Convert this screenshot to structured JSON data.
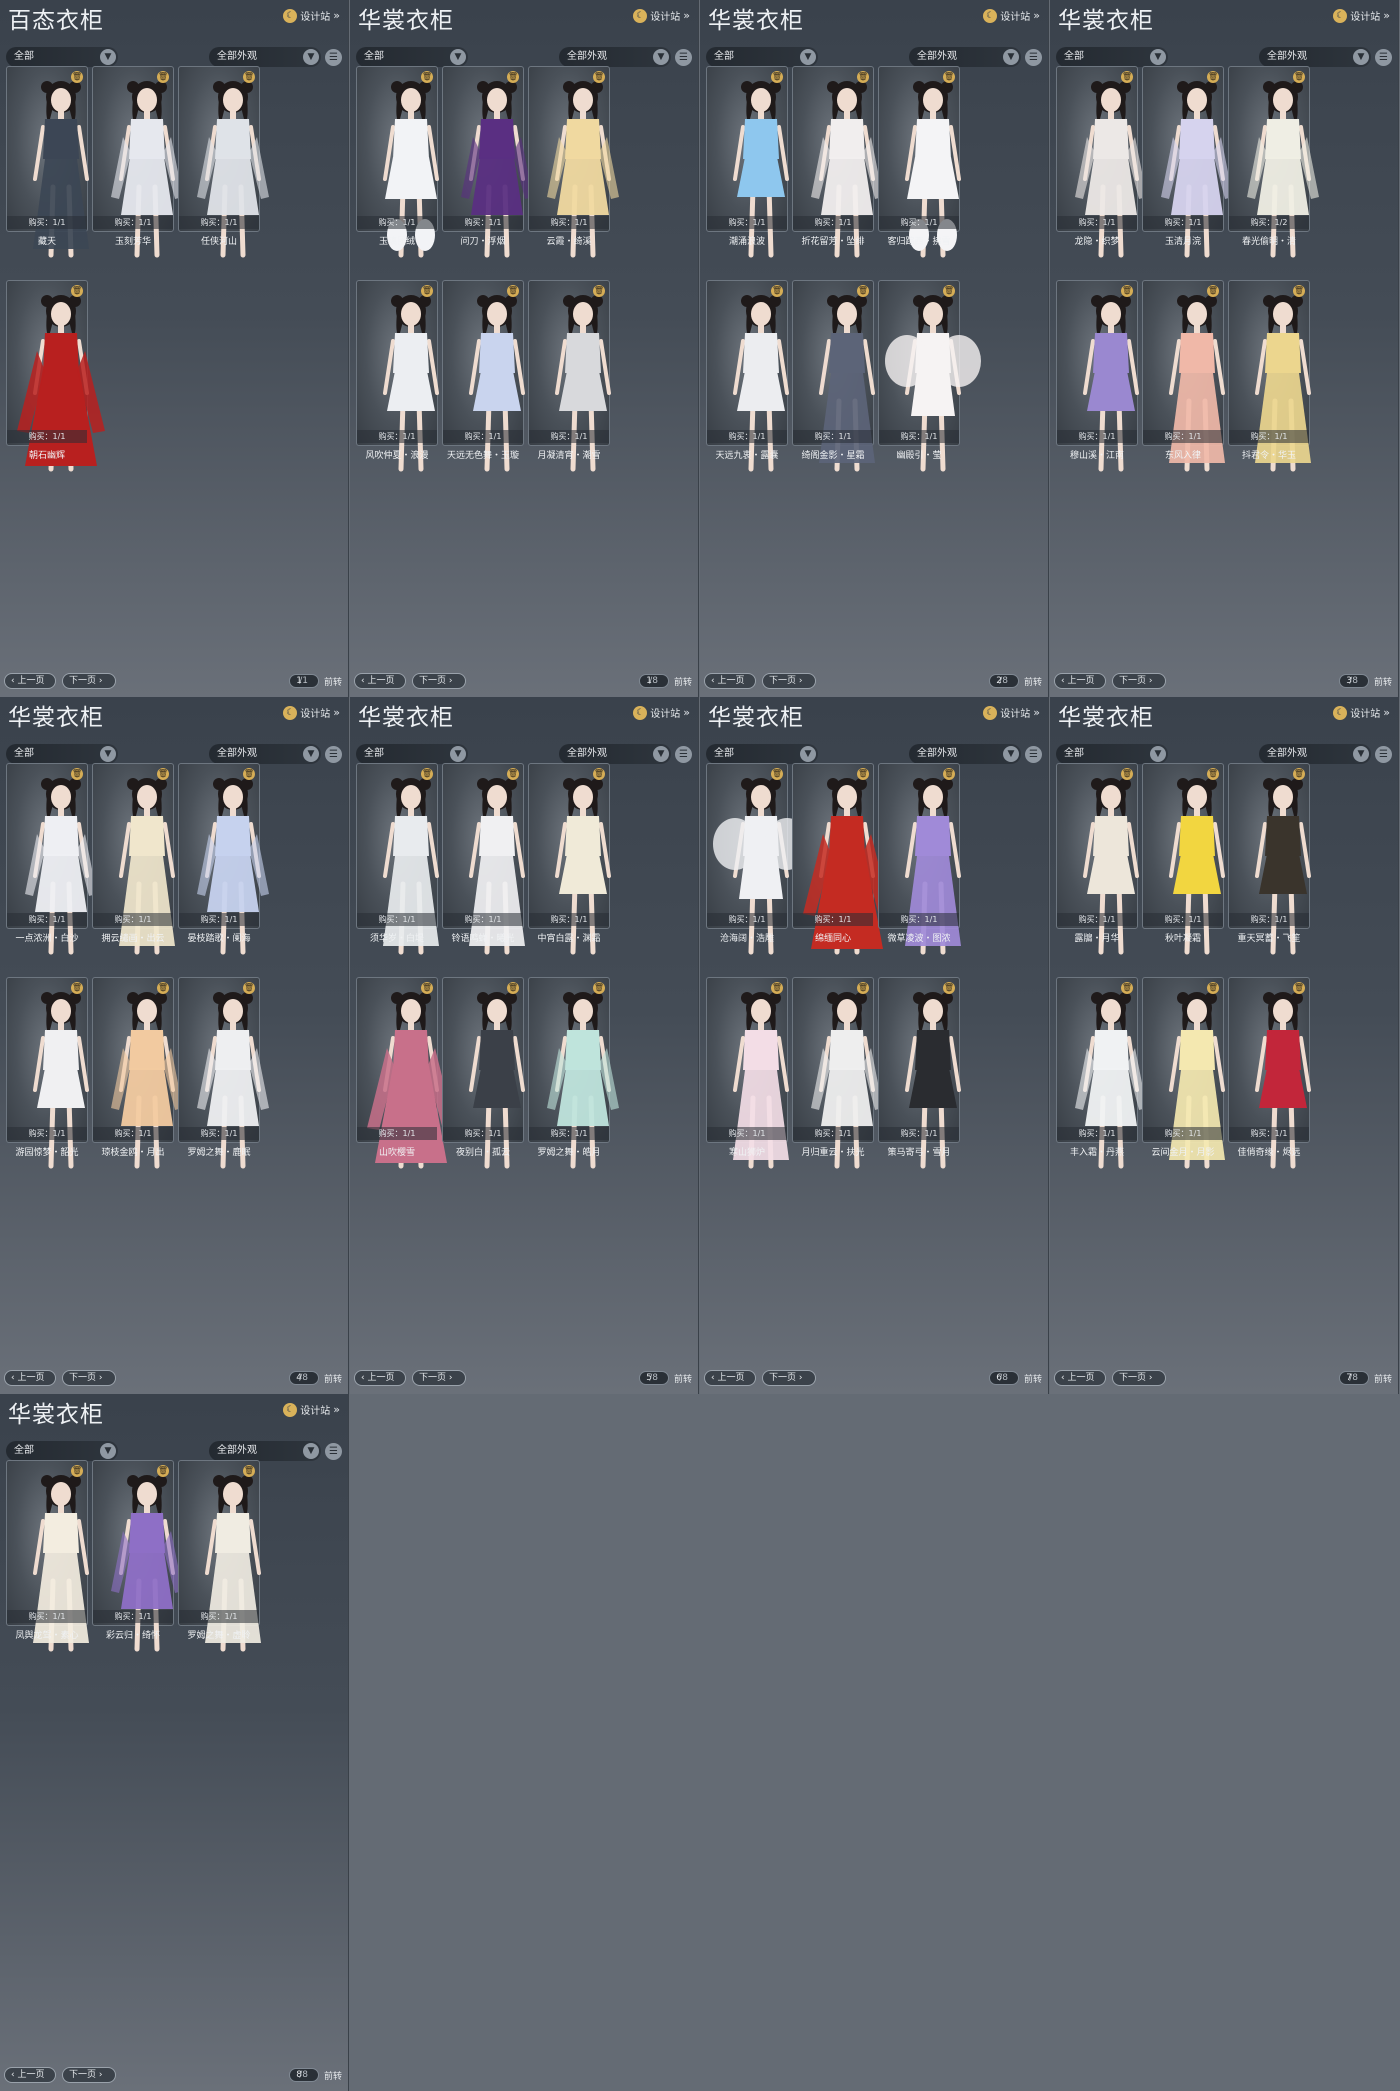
{
  "common": {
    "design_label": "设计站",
    "filter_all": "全部",
    "filter_appearance": "全部外观",
    "prev_label": "上一页",
    "next_label": "下一页",
    "jump_label": "前转"
  },
  "panels": [
    {
      "title": "百态衣柜",
      "page": "1",
      "total": "/1",
      "items": [
        {
          "name": "藏天",
          "buy": "购买：1/1",
          "color": "#3c4655",
          "style": "long"
        },
        {
          "name": "玉刻芳华",
          "buy": "购买：1/1",
          "color": "#e6e8ee",
          "style": "dress"
        },
        {
          "name": "任侠河山",
          "buy": "购买：1/1",
          "color": "#dfe3e8",
          "style": "dress"
        },
        {
          "name": "朝石幽辉",
          "buy": "购买：1/1",
          "color": "#b8201f",
          "style": "robe"
        }
      ]
    },
    {
      "title": "华裳衣柜",
      "page": "1",
      "total": "/8",
      "items": [
        {
          "name": "玉璃团绒",
          "buy": "购买：1/1",
          "color": "#f2f3f6",
          "style": "fluffy"
        },
        {
          "name": "问刀・浮烟",
          "buy": "购买：1/1",
          "color": "#5a2f82",
          "style": "dress"
        },
        {
          "name": "云霞・绮溪",
          "buy": "购买：1/1",
          "color": "#f0d9a0",
          "style": "dress"
        },
        {
          "name": "风吹仲夏・浪漫",
          "buy": "购买：1/1",
          "color": "#eceef2",
          "style": "short"
        },
        {
          "name": "天远无色舞・玉璇",
          "buy": "购买：1/1",
          "color": "#c9d4ee",
          "style": "short"
        },
        {
          "name": "月凝清宵・潮雪",
          "buy": "购买：1/1",
          "color": "#d8d9dc",
          "style": "short"
        }
      ]
    },
    {
      "title": "华裳衣柜",
      "page": "2",
      "total": "/8",
      "items": [
        {
          "name": "潮涌浪波",
          "buy": "购买：1/1",
          "color": "#8ec7ee",
          "style": "short"
        },
        {
          "name": "折花留芳・坠绯",
          "buy": "购买：1/1",
          "color": "#f1eeee",
          "style": "dress"
        },
        {
          "name": "客归踪西・拂雪",
          "buy": "购买：1/1",
          "color": "#f4f4f6",
          "style": "fluffy"
        },
        {
          "name": "天远九衷・露囊",
          "buy": "购买：1/1",
          "color": "#ecedf0",
          "style": "short"
        },
        {
          "name": "绮阁金影・星霜",
          "buy": "购买：1/1",
          "color": "#5c6478",
          "style": "long"
        },
        {
          "name": "幽殿引・莹",
          "buy": "购买：1/1",
          "color": "#f6f3f3",
          "style": "wings"
        }
      ]
    },
    {
      "title": "华裳衣柜",
      "page": "3",
      "total": "/8",
      "items": [
        {
          "name": "龙隐・织梦",
          "buy": "购买：1/1",
          "color": "#ece8e6",
          "style": "dress"
        },
        {
          "name": "玉清月浣",
          "buy": "购买：1/1",
          "color": "#d6d3ee",
          "style": "dress"
        },
        {
          "name": "春光偷明・清",
          "buy": "购买：1/2",
          "color": "#efeee4",
          "style": "dress"
        },
        {
          "name": "穆山溪・江南",
          "buy": "购买：1/1",
          "color": "#9a88d0",
          "style": "short"
        },
        {
          "name": "东风入律",
          "buy": "购买：1/1",
          "color": "#f0b8a8",
          "style": "long"
        },
        {
          "name": "抖君令・华玉",
          "buy": "购买：1/1",
          "color": "#ecd68e",
          "style": "long"
        }
      ]
    },
    {
      "title": "华裳衣柜",
      "page": "4",
      "total": "/8",
      "items": [
        {
          "name": "一点浓洲・白沙",
          "buy": "购买：1/1",
          "color": "#eeeff3",
          "style": "dress"
        },
        {
          "name": "拥云缱画・出云",
          "buy": "购买：1/1",
          "color": "#f0e6cc",
          "style": "long"
        },
        {
          "name": "晏枝踏歌・阑海",
          "buy": "购买：1/1",
          "color": "#c6d2ee",
          "style": "dress"
        },
        {
          "name": "游园惊梦・韶光",
          "buy": "购买：1/1",
          "color": "#f0f0f2",
          "style": "short"
        },
        {
          "name": "琼枝金鸥・月出",
          "buy": "购买：1/1",
          "color": "#f2caa0",
          "style": "dress"
        },
        {
          "name": "罗姆之舞・鹿眠",
          "buy": "购买：1/1",
          "color": "#eeeff1",
          "style": "dress"
        }
      ]
    },
    {
      "title": "华裳衣柜",
      "page": "5",
      "total": "/8",
      "items": [
        {
          "name": "须华岁・白堤",
          "buy": "购买：1/1",
          "color": "#e8ebee",
          "style": "long"
        },
        {
          "name": "铃语鸣蝉・曦光",
          "buy": "购买：1/1",
          "color": "#f0f0f2",
          "style": "long"
        },
        {
          "name": "中宵白露・渊霜",
          "buy": "购买：1/1",
          "color": "#f0ead8",
          "style": "short"
        },
        {
          "name": "山吹樱雪",
          "buy": "购买：1/1",
          "color": "#c8708a",
          "style": "robe"
        },
        {
          "name": "夜别白・孤云",
          "buy": "购买：1/1",
          "color": "#3b4048",
          "style": "short"
        },
        {
          "name": "罗姆之舞・皓月",
          "buy": "购买：1/1",
          "color": "#bfe4dc",
          "style": "dress"
        }
      ]
    },
    {
      "title": "华裳衣柜",
      "page": "6",
      "total": "/8",
      "items": [
        {
          "name": "沧海阔・浩雕",
          "buy": "购买：1/1",
          "color": "#eff0f3",
          "style": "wings"
        },
        {
          "name": "绵缅同心",
          "buy": "购买：1/1",
          "color": "#c42b22",
          "style": "robe"
        },
        {
          "name": "微草凌波・图浓",
          "buy": "购买：1/1",
          "color": "#a08ad8",
          "style": "long"
        },
        {
          "name": "寒山狮炉",
          "buy": "购买：1/1",
          "color": "#f3dde6",
          "style": "long"
        },
        {
          "name": "月归重云・扶光",
          "buy": "购买：1/1",
          "color": "#eeeeee",
          "style": "dress"
        },
        {
          "name": "策马寄弓・雪月",
          "buy": "购买：1/1",
          "color": "#2a2c30",
          "style": "short"
        }
      ]
    },
    {
      "title": "华裳衣柜",
      "page": "7",
      "total": "/8",
      "items": [
        {
          "name": "露牖・月华",
          "buy": "购买：1/1",
          "color": "#ede6da",
          "style": "short"
        },
        {
          "name": "秋叶凝霜",
          "buy": "购买：1/1",
          "color": "#f2d640",
          "style": "short"
        },
        {
          "name": "重天冥蓄・飞笙",
          "buy": "购买：1/1",
          "color": "#3a342c",
          "style": "short"
        },
        {
          "name": "丰入霜・丹燕",
          "buy": "购买：1/1",
          "color": "#f0f2f3",
          "style": "dress"
        },
        {
          "name": "云间金月・月影",
          "buy": "购买：1/1",
          "color": "#f4e8b0",
          "style": "long"
        },
        {
          "name": "佳俏奇缘・烬远",
          "buy": "购买：1/1",
          "color": "#c2263a",
          "style": "short"
        }
      ]
    },
    {
      "title": "华裳衣柜",
      "page": "8",
      "total": "/8",
      "items": [
        {
          "name": "凤舆龙驾・素心",
          "buy": "购买：1/1",
          "color": "#f3ede0",
          "style": "long"
        },
        {
          "name": "彩云归・绮怀",
          "buy": "购买：1/1",
          "color": "#8e6fc6",
          "style": "dress"
        },
        {
          "name": "罗姆之舞・虚聆",
          "buy": "购买：1/1",
          "color": "#f0ece2",
          "style": "long"
        }
      ]
    }
  ]
}
